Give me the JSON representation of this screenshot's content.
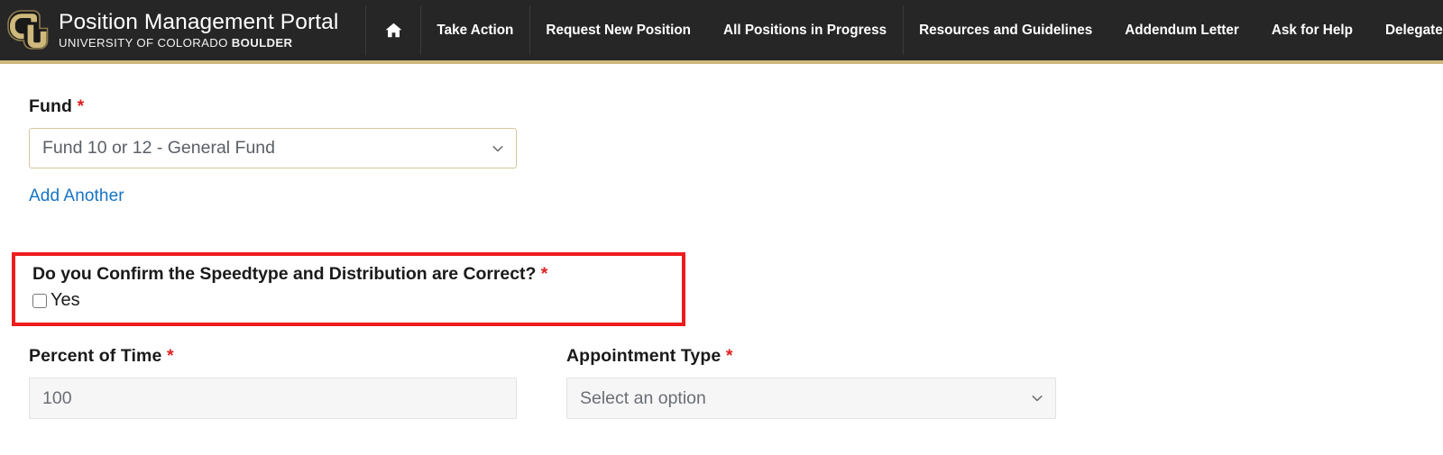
{
  "header": {
    "logo_icon": "cu-logo-icon",
    "title": "Position Management Portal",
    "subtitle_plain": "UNIVERSITY OF COLORADO ",
    "subtitle_bold": "BOULDER",
    "accent_color": "#cfb87c",
    "background_color": "#262626",
    "nav": [
      {
        "label": "",
        "icon": "home-icon"
      },
      {
        "label": "Take Action"
      },
      {
        "label": "Request New Position"
      },
      {
        "label": "All Positions in Progress"
      },
      {
        "label": "Resources and Guidelines"
      },
      {
        "label": "Addendum Letter"
      },
      {
        "label": "Ask for Help"
      },
      {
        "label": "Delegates"
      }
    ]
  },
  "form": {
    "fund": {
      "label": "Fund",
      "required_marker": "*",
      "value": "Fund 10 or 12 - General Fund",
      "dropdown_icon": "chevron-down-icon"
    },
    "add_another": "Add Another",
    "confirm": {
      "question": "Do you Confirm the Speedtype and Distribution are Correct?",
      "required_marker": "*",
      "checkbox_label": "Yes",
      "checked": false,
      "highlight_color": "#ee1c1c"
    },
    "percent_of_time": {
      "label": "Percent of Time",
      "required_marker": "*",
      "value": "100"
    },
    "appointment_type": {
      "label": "Appointment Type",
      "required_marker": "*",
      "value": "Select an option",
      "dropdown_icon": "chevron-down-icon"
    }
  },
  "colors": {
    "link": "#1674c4",
    "required": "#e02020",
    "select_border": "#d7c49b",
    "input_background": "#f6f6f6"
  }
}
